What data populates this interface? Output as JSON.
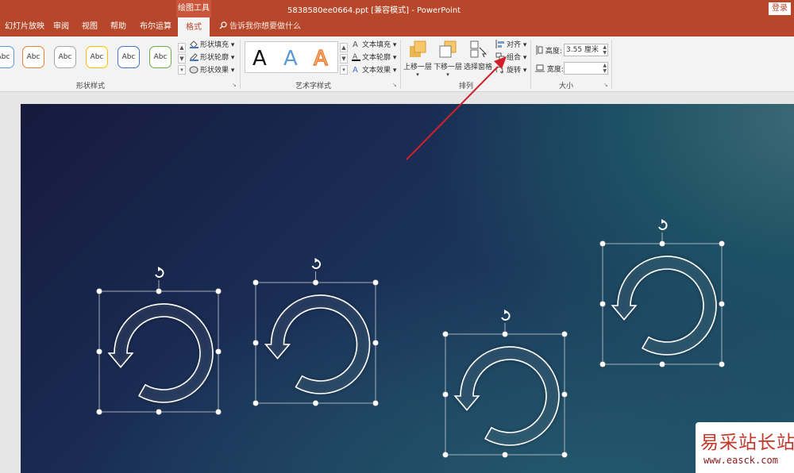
{
  "app": {
    "title": "5838580ee0664.ppt [兼容模式]  -  PowerPoint",
    "contextual_tab_group": "绘图工具",
    "login_label": "登录"
  },
  "tabs": [
    {
      "label": "幻灯片放映"
    },
    {
      "label": "审阅"
    },
    {
      "label": "视图"
    },
    {
      "label": "帮助"
    },
    {
      "label": "布尔运算"
    },
    {
      "label": "格式",
      "active": true
    }
  ],
  "tell_me": "告诉我你想要做什么",
  "ribbon": {
    "shape_styles": {
      "label": "形状样式",
      "gallery": [
        "Abc",
        "Abc",
        "Abc",
        "Abc",
        "Abc",
        "Abc"
      ],
      "gallery_colors": [
        "#5b9bd5",
        "#ed7d31",
        "#a5a5a5",
        "#ffc000",
        "#4472c4",
        "#70ad47"
      ],
      "fill": "形状填充",
      "outline": "形状轮廓",
      "effects": "形状效果"
    },
    "wordart_styles": {
      "label": "艺术字样式",
      "letters": [
        "A",
        "A",
        "A"
      ],
      "text_fill": "文本填充",
      "text_outline": "文本轮廓",
      "text_effects": "文本效果"
    },
    "arrange": {
      "label": "排列",
      "bring_forward": "上移一层",
      "send_backward": "下移一层",
      "selection_pane": "选择窗格",
      "align": "对齐",
      "group": "组合",
      "rotate": "旋转"
    },
    "size": {
      "label": "大小",
      "height_label": "高度:",
      "height_value": "3.55 厘米",
      "width_label": "宽度:",
      "width_value": ""
    }
  },
  "slide": {
    "shapes": [
      {
        "name": "circular-arrow-1"
      },
      {
        "name": "circular-arrow-2"
      },
      {
        "name": "circular-arrow-3"
      },
      {
        "name": "circular-arrow-4"
      }
    ]
  },
  "annotation": {
    "color": "#d0202a"
  },
  "watermark": {
    "title": "易采站长站",
    "url": "www.easck.com"
  }
}
